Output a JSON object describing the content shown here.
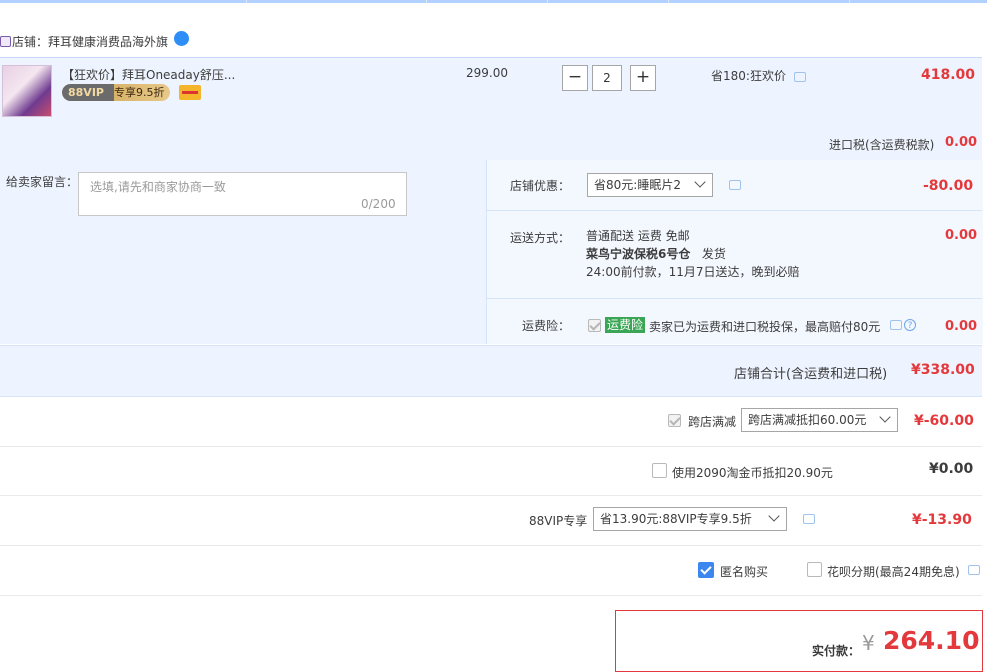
{
  "shop": {
    "label": "店铺：拜耳健康消费品海外旗"
  },
  "item": {
    "title": "【狂欢价】拜耳Oneaday舒压...",
    "vip_tag": "88VIP",
    "vip_discount": "专享9.5折",
    "price": "299.00",
    "quantity": "2",
    "minus": "−",
    "plus": "+",
    "saving": "省180:狂欢价",
    "total": "418.00"
  },
  "import_tax": {
    "label": "进口税(含运费税款)",
    "value": "0.00"
  },
  "message": {
    "label": "给卖家留言：",
    "placeholder": "选填,请先和商家协商一致",
    "count": "0/200"
  },
  "shop_discount": {
    "label": "店铺优惠：",
    "selected": "省80元:睡眠片2",
    "value": "-80.00"
  },
  "shipping": {
    "label": "运送方式：",
    "line1": "普通配送 运费 免邮",
    "line2": "菜鸟宁波保税6号仓",
    "line2b": "发货",
    "line3": "24:00前付款，11月7日送达，晚到必赔",
    "value": "0.00"
  },
  "freight_insurance": {
    "label": "运费险：",
    "tag": "运费险",
    "text": "卖家已为运费和进口税投保，最高赔付80元",
    "value": "0.00"
  },
  "shop_total": {
    "label": "店铺合计(含运费和进口税)",
    "value": "¥338.00"
  },
  "cross_store": {
    "label": "跨店满减",
    "selected": "跨店满减抵扣60.00元",
    "value": "¥-60.00"
  },
  "taobao_coin": {
    "label": "使用2090淘金币抵扣20.90元",
    "value": "¥0.00"
  },
  "vip88": {
    "label": "88VIP专享",
    "selected": "省13.90元:88VIP专享9.5折",
    "value": "¥-13.90"
  },
  "anonymous": {
    "label": "匿名购买"
  },
  "huabei": {
    "label": "花呗分期(最高24期免息)"
  },
  "payment": {
    "label": "实付款：",
    "currency": "¥",
    "amount": "264.10"
  }
}
